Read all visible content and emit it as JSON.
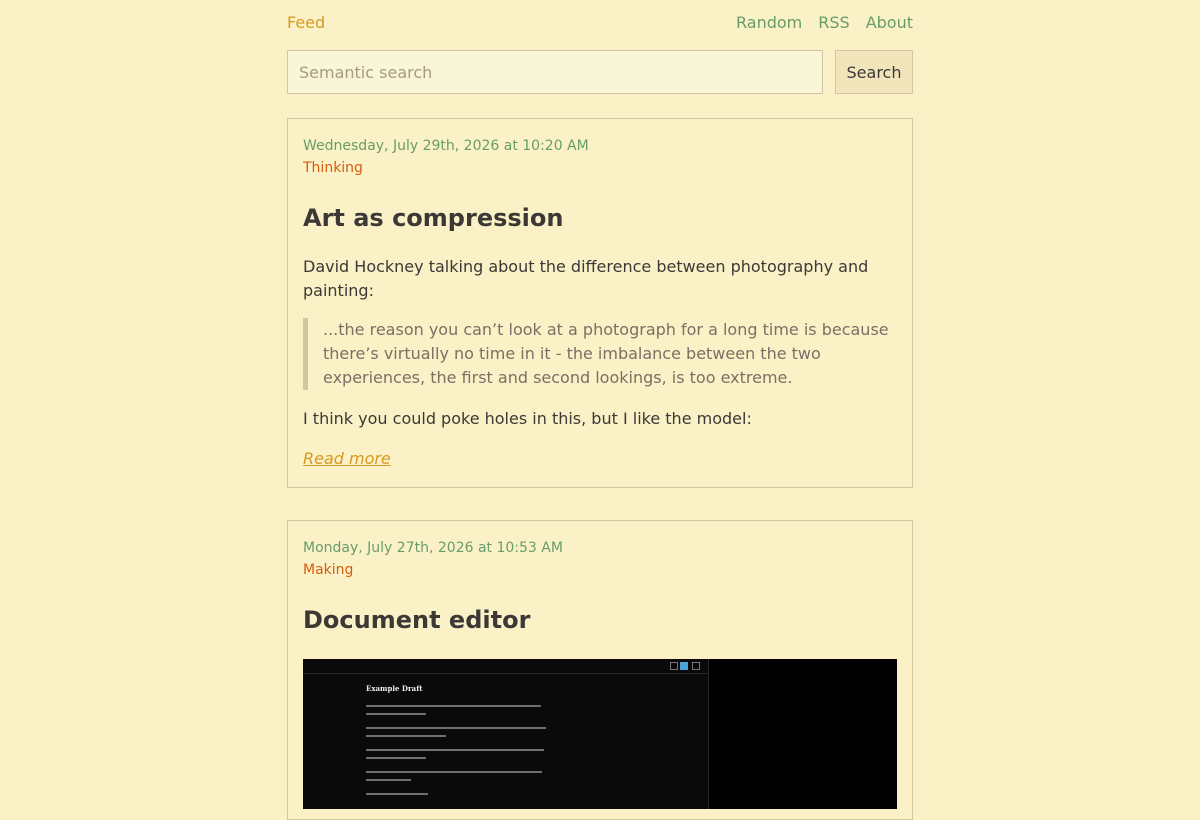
{
  "nav": {
    "feed": "Feed",
    "random": "Random",
    "rss": "RSS",
    "about": "About"
  },
  "search": {
    "placeholder": "Semantic search",
    "button": "Search"
  },
  "posts": [
    {
      "date": "Wednesday, July 29th, 2026 at 10:20 AM",
      "category": "Thinking",
      "title": "Art as compression",
      "intro": "David Hockney talking about the difference between photography and painting:",
      "quote": "...the reason you can’t look at a photograph for a long time is because there’s virtually no time in it - the imbalance between the two experiences, the first and second lookings, is too extreme.",
      "outro": "I think you could poke holes in this, but I like the model:",
      "read_more": "Read more"
    },
    {
      "date": "Monday, July 27th, 2026 at 10:53 AM",
      "category": "Making",
      "title": "Document editor",
      "screenshot_title": "Example Draft"
    }
  ]
}
